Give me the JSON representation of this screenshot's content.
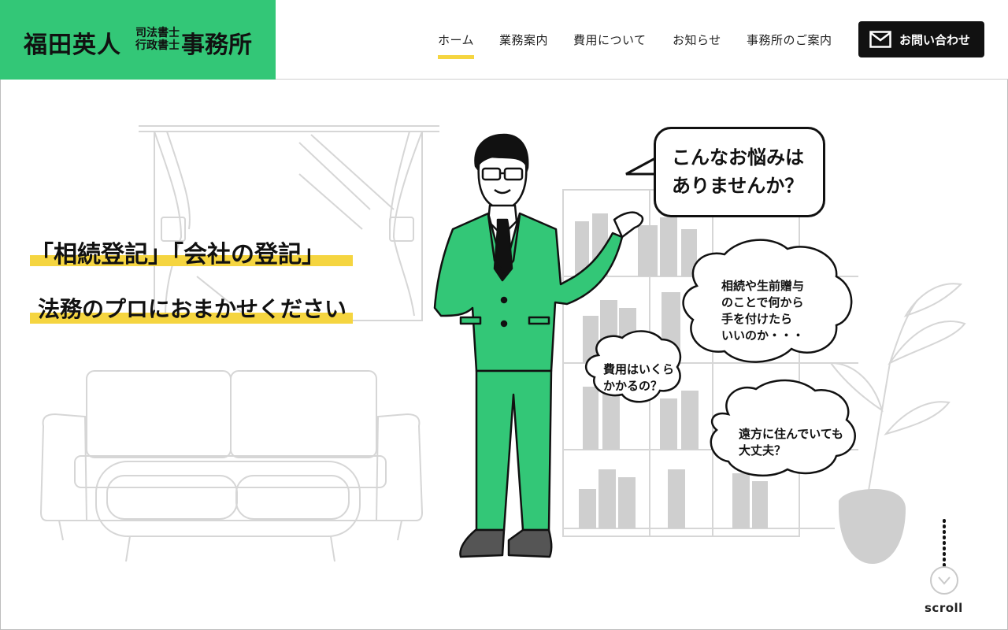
{
  "header": {
    "logo_name": "福田英人",
    "logo_title1": "司法書士",
    "logo_title2": "行政書士",
    "logo_office": "事務所",
    "nav": [
      {
        "label": "ホーム",
        "active": true
      },
      {
        "label": "業務案内",
        "active": false
      },
      {
        "label": "費用について",
        "active": false
      },
      {
        "label": "お知らせ",
        "active": false
      },
      {
        "label": "事務所のご案内",
        "active": false
      }
    ],
    "contact_label": "お問い合わせ"
  },
  "hero": {
    "catch1": "「相続登記」「会社の登記」",
    "catch2": "法務のプロにおまかせください",
    "speech_line1": "こんなお悩みは",
    "speech_line2": "ありませんか？",
    "worry1": [
      "相続や生前贈与",
      "のことで何から",
      "手を付けたら",
      "いいのか・・・"
    ],
    "worry2": [
      "費用はいくら",
      "かかるの？"
    ],
    "worry3": [
      "遠方に住んでいても",
      "大丈夫？"
    ],
    "scroll_label": "scroll"
  },
  "colors": {
    "brand_green": "#33c777",
    "accent_yellow": "#f5d540",
    "dark": "#111111"
  },
  "icons": {
    "contact": "mail-icon",
    "scroll": "chevron-down-icon"
  }
}
